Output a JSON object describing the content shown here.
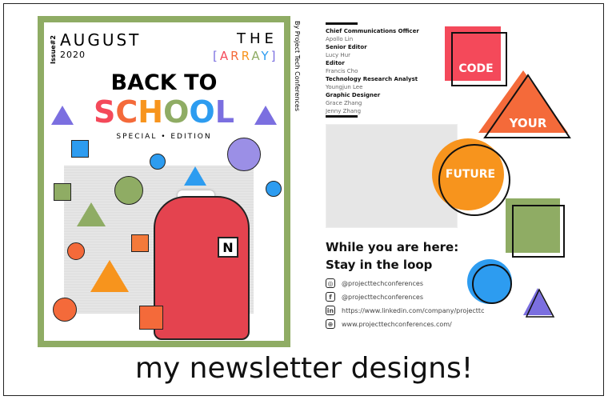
{
  "cover": {
    "issue": "Issue#2",
    "month": "AUGUST",
    "year": "2020",
    "the": "THE",
    "array": "[ARRAY]",
    "headline1": "BACK TO",
    "headline2": [
      "S",
      "C",
      "H",
      "O",
      "O",
      "L"
    ],
    "headline2_colors": [
      "#f4495a",
      "#f46a3a",
      "#f7941d",
      "#8fac64",
      "#2d9cf0",
      "#7b6fe0"
    ],
    "edition": "SPECIAL • EDITION",
    "byline": "By Project Tech Conferences",
    "frame_color": "#8fac64"
  },
  "back": {
    "staff": [
      {
        "role": "Chief Communications Officer",
        "names": [
          "Apollo Lin"
        ]
      },
      {
        "role": "Senior Editor",
        "names": [
          "Lucy Hur"
        ]
      },
      {
        "role": "Editor",
        "names": [
          "Francis Cho"
        ]
      },
      {
        "role": "Technology Research Analyst",
        "names": [
          "Youngjun Lee"
        ]
      },
      {
        "role": "Graphic Designer",
        "names": [
          "Grace Zhang",
          "Jenny Zhang"
        ]
      }
    ],
    "cta1": "While you are here:",
    "cta2": "Stay in the loop",
    "social": [
      {
        "icon": "instagram-icon",
        "glyph": "◎",
        "text": "@projecttechconferences"
      },
      {
        "icon": "facebook-icon",
        "glyph": "f",
        "text": "@projecttechconferences"
      },
      {
        "icon": "linkedin-icon",
        "glyph": "in",
        "text": "https://www.linkedin.com/company/projecttc"
      },
      {
        "icon": "globe-icon",
        "glyph": "⊕",
        "text": "www.projecttechconferences.com/"
      }
    ],
    "words": [
      "CODE",
      "YOUR",
      "FUTURE"
    ]
  },
  "caption": "my newsletter designs!"
}
